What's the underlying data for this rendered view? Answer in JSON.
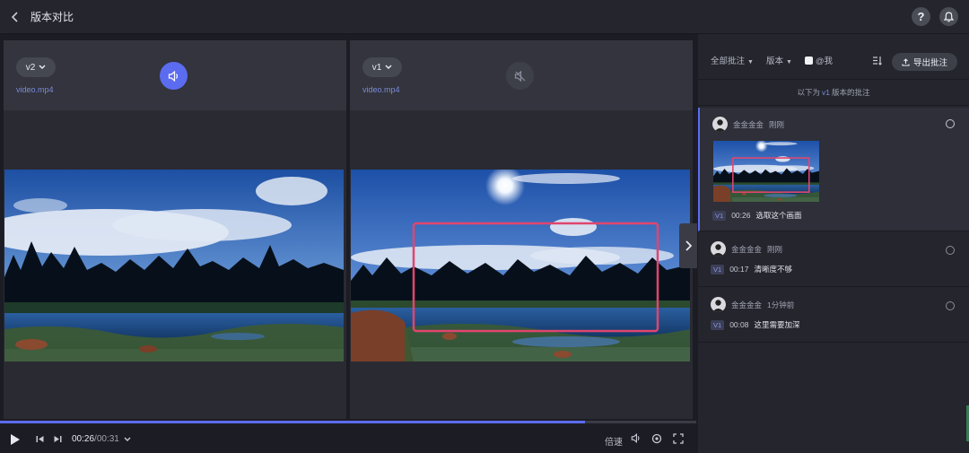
{
  "header": {
    "title": "版本对比"
  },
  "panes": [
    {
      "version": "v2",
      "filename": "video.mp4",
      "audio": "on"
    },
    {
      "version": "v1",
      "filename": "video.mp4",
      "audio": "muted"
    }
  ],
  "player": {
    "current": "00:26",
    "separator": "/",
    "total": "00:31",
    "progress": 0.84,
    "speed_label": "倍速"
  },
  "sidebar": {
    "filter_all": "全部批注",
    "filter_version": "版本",
    "filter_mention": "@我",
    "export_label": "导出批注",
    "sub_note_prefix": "以下为",
    "sub_note_version": "v1",
    "sub_note_suffix": "版本的批注",
    "comments": [
      {
        "author": "金金金金",
        "time": "刚刚",
        "version": "V1",
        "timestamp": "00:26",
        "text": "选取这个画面",
        "has_thumb": true
      },
      {
        "author": "金金金金",
        "time": "刚刚",
        "version": "V1",
        "timestamp": "00:17",
        "text": "清晰度不够",
        "has_thumb": false
      },
      {
        "author": "金金金金",
        "time": "1分钟前",
        "version": "V1",
        "timestamp": "00:08",
        "text": "这里需要加深",
        "has_thumb": false
      }
    ]
  },
  "colors": {
    "accent": "#5b6cf0",
    "annotation": "#e0456e",
    "panel": "#292a32",
    "sidebar": "#24252d"
  }
}
